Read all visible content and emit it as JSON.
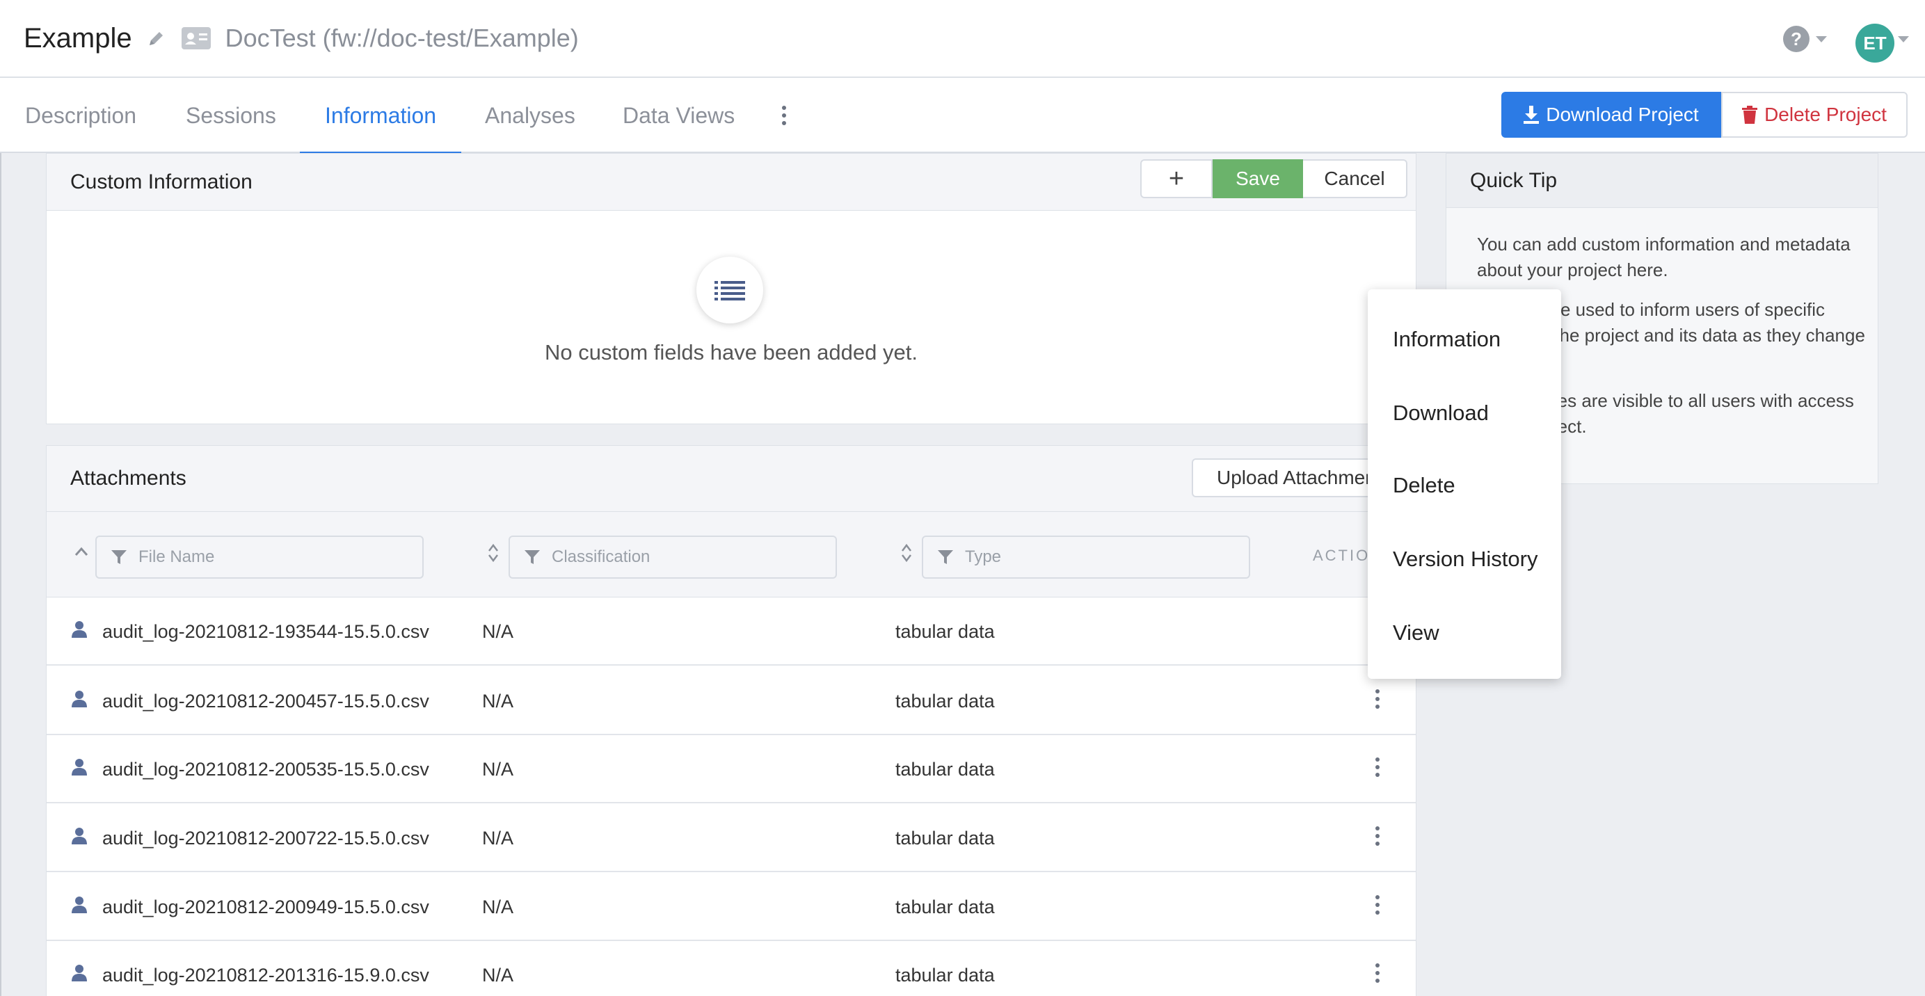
{
  "header": {
    "title": "Example",
    "subtitle": "DocTest (fw://doc-test/Example)",
    "avatar_initials": "ET"
  },
  "tabs": [
    {
      "label": "Description"
    },
    {
      "label": "Sessions"
    },
    {
      "label": "Information"
    },
    {
      "label": "Analyses"
    },
    {
      "label": "Data Views"
    }
  ],
  "actions": {
    "download_label": "Download Project",
    "delete_label": "Delete Project"
  },
  "custom_info": {
    "title": "Custom Information",
    "add_label": "+",
    "save_label": "Save",
    "cancel_label": "Cancel",
    "empty_text": "No custom fields have been added yet."
  },
  "quick_tip": {
    "title": "Quick Tip",
    "paragraphs": [
      "You can add custom information and metadata about your project here.",
      "This can be used to inform users of specific details of the project and its data as they change over time.",
      "These notes are visible to all users with access to the project."
    ]
  },
  "attachments": {
    "title": "Attachments",
    "upload_label": "Upload Attachment",
    "filters": {
      "file_name": "File Name",
      "classification": "Classification",
      "type": "Type"
    },
    "actions_header": "ACTIONS",
    "rows": [
      {
        "file": "audit_log-20210812-193544-15.5.0.csv",
        "classification": "N/A",
        "type": "tabular data"
      },
      {
        "file": "audit_log-20210812-200457-15.5.0.csv",
        "classification": "N/A",
        "type": "tabular data"
      },
      {
        "file": "audit_log-20210812-200535-15.5.0.csv",
        "classification": "N/A",
        "type": "tabular data"
      },
      {
        "file": "audit_log-20210812-200722-15.5.0.csv",
        "classification": "N/A",
        "type": "tabular data"
      },
      {
        "file": "audit_log-20210812-200949-15.5.0.csv",
        "classification": "N/A",
        "type": "tabular data"
      },
      {
        "file": "audit_log-20210812-201316-15.9.0.csv",
        "classification": "N/A",
        "type": "tabular data"
      }
    ]
  },
  "context_menu": {
    "items": [
      "Information",
      "Download",
      "Delete",
      "Version History",
      "View"
    ]
  },
  "colors": {
    "accent": "#2c7be5",
    "danger": "#d0343f",
    "save": "#6bb36b",
    "avatar": "#3aa89a"
  }
}
